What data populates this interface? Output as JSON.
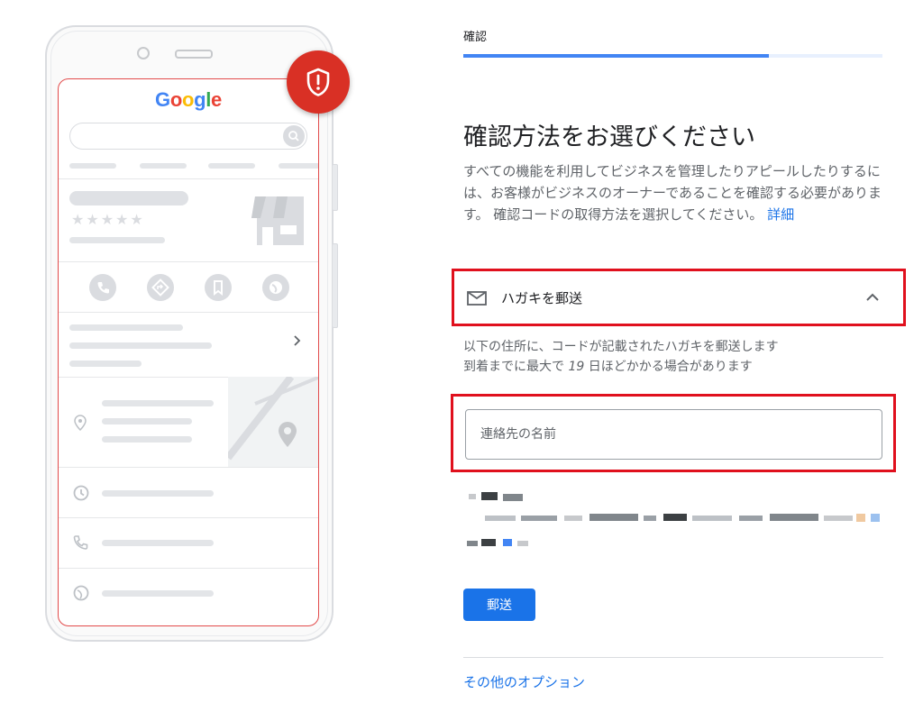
{
  "phone": {
    "logo_letters": [
      {
        "ch": "G",
        "color": "#4285f4"
      },
      {
        "ch": "o",
        "color": "#ea4335"
      },
      {
        "ch": "o",
        "color": "#fbbc05"
      },
      {
        "ch": "g",
        "color": "#4285f4"
      },
      {
        "ch": "l",
        "color": "#34a853"
      },
      {
        "ch": "e",
        "color": "#ea4335"
      }
    ],
    "stars": "★★★★★",
    "icons": [
      "search-icon",
      "storefront-icon",
      "phone-icon",
      "directions-icon",
      "bookmark-icon",
      "globe-icon",
      "location-pin-icon",
      "clock-icon",
      "web-icon",
      "shield-alert-icon"
    ]
  },
  "header": {
    "step_label": "確認",
    "progress": 0.73
  },
  "main": {
    "title": "確認方法をお選びください",
    "description": "すべての機能を利用してビジネスを管理したりアピールしたりするには、お客様がビジネスのオーナーであることを確認する必要があります。 確認コードの取得方法を選択してください。",
    "details_link": "詳細",
    "option": {
      "icon": "mail-icon",
      "label": "ハガキを郵送",
      "expanded": true
    },
    "info_line1": "以下の住所に、コードが記載されたハガキを郵送します",
    "info_line2_prefix": "到着までに最大で ",
    "info_days": "19",
    "info_line2_suffix": " 日ほどかかる場合があります",
    "contact_placeholder": "連絡先の名前",
    "send_button": "郵送",
    "other_options": "その他のオプション"
  },
  "colors": {
    "accent": "#1a73e8",
    "progress": "#4285f4",
    "highlight_frame": "#e0101d",
    "badge": "#d93025"
  }
}
